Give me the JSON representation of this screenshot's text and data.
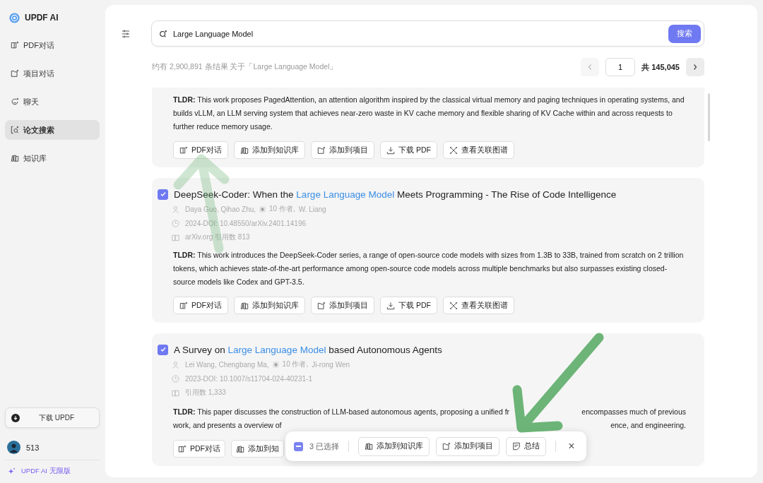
{
  "sidebar": {
    "brand": "UPDF AI",
    "items": [
      {
        "label": "PDF对话",
        "selected": false
      },
      {
        "label": "项目对话",
        "selected": false
      },
      {
        "label": "聊天",
        "selected": false
      },
      {
        "label": "论文搜索",
        "selected": true
      },
      {
        "label": "知识库",
        "selected": false
      }
    ],
    "download_button": "下载 UPDF",
    "user": "513",
    "plan_link": "UPDF AI 无限版"
  },
  "search": {
    "value": "Large Language Model",
    "button": "搜索"
  },
  "summary": "约有 2,900,891 条结果 关于「Large Language Model」",
  "pagination": {
    "page": "1",
    "total": "共 145,045",
    "prev_disabled": true
  },
  "results": [
    {
      "tldr": "**TLDR:** This work proposes PagedAttention, an attention algorithm inspired by the classical virtual memory and paging techniques in operating systems, and builds vLLM, an LLM serving system that achieves near-zero waste in KV cache memory and flexible sharing of KV Cache within and across requests to further reduce memory usage.",
      "actions": [
        "PDF对话",
        "添加到知识库",
        "添加到项目",
        "下载 PDF",
        "查看关联图谱"
      ]
    },
    {
      "checked": true,
      "title": [
        {
          "text": "DeepSeek-Coder: When the ",
          "highlight": false
        },
        {
          "text": "Large Language Model",
          "highlight": true
        },
        {
          "text": " Meets Programming - The Rise of Code Intelligence",
          "highlight": false
        }
      ],
      "authors": "Daya Guo,  Qihao Zhu,",
      "more_authors": "10 作者,",
      "last_author": "W. Liang",
      "doi": "2024-DOI: 10.48550/arXiv.2401.14196",
      "source": "arXiv.org  引用数 813",
      "tldr": "**TLDR:** This work introduces the DeepSeek-Coder series, a range of open-source code models with sizes from 1.3B to 33B, trained from scratch on 2 trillion tokens, which achieves state-of-the-art performance among open-source code models across multiple benchmarks but also surpasses existing closed-source models like Codex and GPT-3.5.",
      "actions": [
        "PDF对话",
        "添加到知识库",
        "添加到项目",
        "下载 PDF",
        "查看关联图谱"
      ]
    },
    {
      "checked": true,
      "title": [
        {
          "text": "A Survey on ",
          "highlight": false
        },
        {
          "text": "Large Language Model",
          "highlight": true
        },
        {
          "text": " based Autonomous Agents",
          "highlight": false
        }
      ],
      "authors": "Lei Wang,  Chengbang Ma,",
      "more_authors": "10 作者,",
      "last_author": "Ji-rong Wen",
      "doi": "2023-DOI: 10.1007/s11704-024-40231-1",
      "source": "引用数 1,333",
      "tldr_visible": [
        {
          "left": "**TLDR:** This paper discusses the construction of LLM-based autonomous agents, proposing a unified fr",
          "right": "encompasses much of previous"
        },
        {
          "left": "work, and presents a overview of",
          "right": "ence, and engineering."
        }
      ],
      "actions": [
        "PDF对话",
        "添加到知"
      ]
    }
  ],
  "selection_bar": {
    "count": "3 已选择",
    "actions": [
      "添加到知识库",
      "添加到项目",
      "总结"
    ],
    "close": "×"
  }
}
